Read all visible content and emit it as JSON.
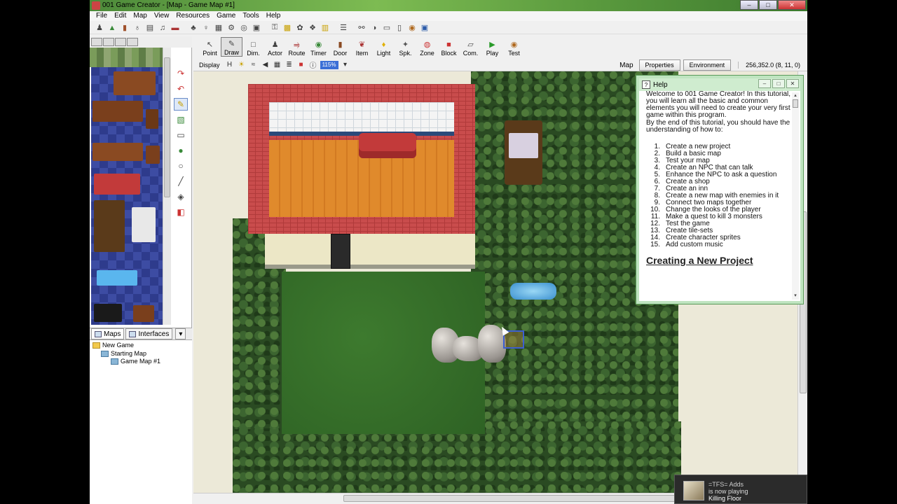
{
  "window": {
    "title": "001 Game Creator - [Map - Game Map #1]",
    "controls": [
      "–",
      "□",
      "✕"
    ]
  },
  "menu": [
    "File",
    "Edit",
    "Map",
    "View",
    "Resources",
    "Game",
    "Tools",
    "Help"
  ],
  "tools": [
    "Point",
    "Draw",
    "Dim.",
    "Actor",
    "Route",
    "Timer",
    "Door",
    "Item",
    "Light",
    "Spk.",
    "Zone",
    "Block",
    "Com.",
    "Play",
    "Test"
  ],
  "selected_tool": "Draw",
  "display_bar": {
    "label": "Display",
    "zoom": "115%"
  },
  "map_bar": {
    "label": "Map",
    "properties": "Properties",
    "environment": "Environment",
    "coords": "256,352.0 (8, 11, 0)"
  },
  "tree_tabs": {
    "maps": "Maps",
    "interfaces": "Interfaces"
  },
  "tree": {
    "root": "New Game",
    "folder": "Starting Map",
    "map": "Game Map #1"
  },
  "help": {
    "title": "Help",
    "intro1": "Welcome to 001 Game Creator! In this tutorial, you will learn all the basic and common elements you will need to create your very first game within this program.",
    "intro2": "By the end of this tutorial, you should have the understanding of how to:",
    "items": [
      {
        "n": "1.",
        "text": "Create a new project"
      },
      {
        "n": "2.",
        "text": "Build a basic map"
      },
      {
        "n": "3.",
        "text": "Test your map"
      },
      {
        "n": "4.",
        "text": "Create an NPC that can talk"
      },
      {
        "n": "5.",
        "text": "Enhance the NPC to ask a question"
      },
      {
        "n": "6.",
        "text": "Create a shop"
      },
      {
        "n": "7.",
        "text": "Create an inn"
      },
      {
        "n": "8.",
        "text": "Create a new map with enemies in it"
      },
      {
        "n": "9.",
        "text": "Connect two maps together"
      },
      {
        "n": "10.",
        "text": "Change the looks of the player"
      },
      {
        "n": "11.",
        "text": "Make a quest to kill 3 monsters"
      },
      {
        "n": "12.",
        "text": "Test the game"
      },
      {
        "n": "13.",
        "text": "Create tile-sets"
      },
      {
        "n": "14.",
        "text": "Create character sprites"
      },
      {
        "n": "15.",
        "text": "Add custom music"
      }
    ],
    "heading": "Creating a New Project"
  },
  "notification": {
    "user": "=TFS= Adds",
    "status": "is now playing",
    "game": "Killing Floor"
  }
}
